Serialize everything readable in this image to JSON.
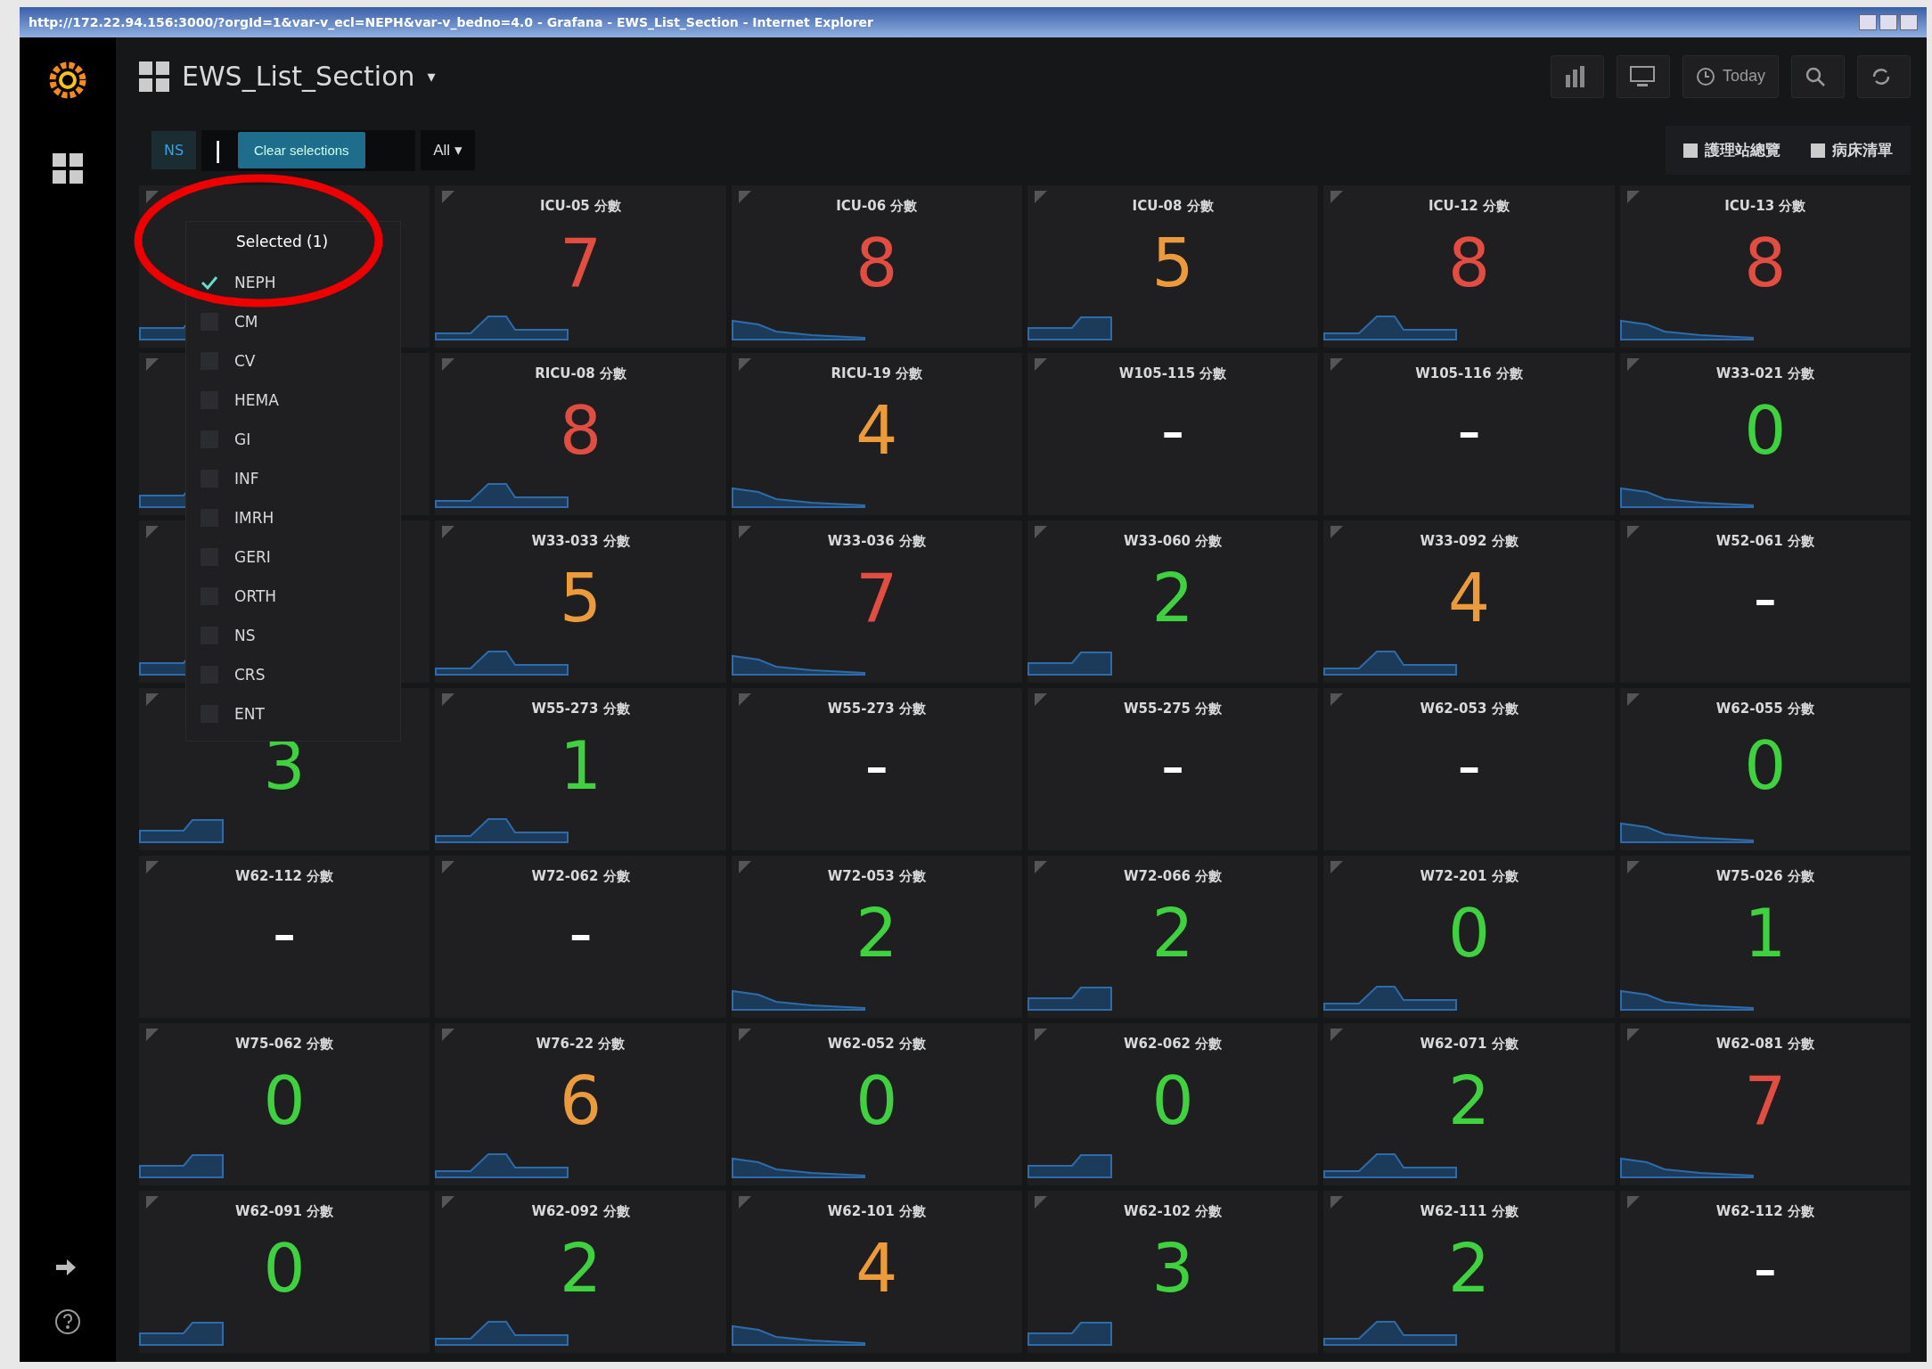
{
  "window": {
    "title": "http://172.22.94.156:3000/?orgId=1&var-v_ecl=NEPH&var-v_bedno=4.0 - Grafana - EWS_List_Section - Internet Explorer"
  },
  "header": {
    "dashboard_title": "EWS_List_Section",
    "caret": "▾",
    "time_picker": "Today"
  },
  "variables": {
    "label": "NS",
    "cursor": "|",
    "clear_button": "Clear selections",
    "all_dropdown": "All ▾"
  },
  "links": [
    "護理站總覽",
    "病床清單"
  ],
  "dropdown": {
    "header": "Selected (1)",
    "options": [
      {
        "label": "NEPH",
        "checked": true
      },
      {
        "label": "CM",
        "checked": false
      },
      {
        "label": "CV",
        "checked": false
      },
      {
        "label": "HEMA",
        "checked": false
      },
      {
        "label": "GI",
        "checked": false
      },
      {
        "label": "INF",
        "checked": false
      },
      {
        "label": "IMRH",
        "checked": false
      },
      {
        "label": "GERI",
        "checked": false
      },
      {
        "label": "ORTH",
        "checked": false
      },
      {
        "label": "NS",
        "checked": false
      },
      {
        "label": "CRS",
        "checked": false
      },
      {
        "label": "ENT",
        "checked": false
      }
    ]
  },
  "panels": [
    {
      "kind": "covered",
      "sparkline": true
    },
    {
      "kind": "stat",
      "title": "ICU-05 分數",
      "value": "7",
      "color": "#e24d42",
      "sparkline": true
    },
    {
      "kind": "stat",
      "title": "ICU-06 分數",
      "value": "8",
      "color": "#e24d42",
      "sparkline": true
    },
    {
      "kind": "stat",
      "title": "ICU-08 分數",
      "value": "5",
      "color": "#eb9a3c",
      "sparkline": true
    },
    {
      "kind": "stat",
      "title": "ICU-12 分數",
      "value": "8",
      "color": "#e24d42",
      "sparkline": true
    },
    {
      "kind": "stat",
      "title": "ICU-13 分數",
      "value": "8",
      "color": "#e24d42",
      "sparkline": true
    },
    {
      "kind": "covered",
      "sparkline": true
    },
    {
      "kind": "stat",
      "title": "RICU-08 分數",
      "value": "8",
      "color": "#e24d42",
      "sparkline": true
    },
    {
      "kind": "stat",
      "title": "RICU-19 分數",
      "value": "4",
      "color": "#eb9a3c",
      "sparkline": true
    },
    {
      "kind": "stat",
      "title": "W105-115 分數",
      "value": "-",
      "color": "#ffffff",
      "sparkline": false
    },
    {
      "kind": "stat",
      "title": "W105-116 分數",
      "value": "-",
      "color": "#ffffff",
      "sparkline": false
    },
    {
      "kind": "stat",
      "title": "W33-021 分數",
      "value": "0",
      "color": "#3fd13f",
      "sparkline": true
    },
    {
      "kind": "covered",
      "sparkline": true
    },
    {
      "kind": "stat",
      "title": "W33-033 分數",
      "value": "5",
      "color": "#eb9a3c",
      "sparkline": true
    },
    {
      "kind": "stat",
      "title": "W33-036 分數",
      "value": "7",
      "color": "#e24d42",
      "sparkline": true
    },
    {
      "kind": "stat",
      "title": "W33-060 分數",
      "value": "2",
      "color": "#3fd13f",
      "sparkline": true
    },
    {
      "kind": "stat",
      "title": "W33-092 分數",
      "value": "4",
      "color": "#eb9a3c",
      "sparkline": true
    },
    {
      "kind": "stat",
      "title": "W52-061 分數",
      "value": "-",
      "color": "#ffffff",
      "sparkline": false
    },
    {
      "kind": "stat",
      "value": "3",
      "color": "#3fd13f",
      "sparkline": true
    },
    {
      "kind": "stat",
      "title": "W55-273 分數",
      "value": "1",
      "color": "#3fd13f",
      "sparkline": true
    },
    {
      "kind": "stat",
      "title": "W55-273 分數",
      "value": "-",
      "color": "#ffffff",
      "sparkline": false
    },
    {
      "kind": "stat",
      "title": "W55-275 分數",
      "value": "-",
      "color": "#ffffff",
      "sparkline": false
    },
    {
      "kind": "stat",
      "title": "W62-053 分數",
      "value": "-",
      "color": "#ffffff",
      "sparkline": false
    },
    {
      "kind": "stat",
      "title": "W62-055 分數",
      "value": "0",
      "color": "#3fd13f",
      "sparkline": true
    },
    {
      "kind": "stat",
      "title": "W62-112 分數",
      "value": "-",
      "color": "#ffffff",
      "sparkline": false
    },
    {
      "kind": "stat",
      "title": "W72-062 分數",
      "value": "-",
      "color": "#ffffff",
      "sparkline": false
    },
    {
      "kind": "stat",
      "title": "W72-053 分數",
      "value": "2",
      "color": "#3fd13f",
      "sparkline": true
    },
    {
      "kind": "stat",
      "title": "W72-066 分數",
      "value": "2",
      "color": "#3fd13f",
      "sparkline": true
    },
    {
      "kind": "stat",
      "title": "W72-201 分數",
      "value": "0",
      "color": "#3fd13f",
      "sparkline": true
    },
    {
      "kind": "stat",
      "title": "W75-026 分數",
      "value": "1",
      "color": "#3fd13f",
      "sparkline": true
    },
    {
      "kind": "stat",
      "title": "W75-062 分數",
      "value": "0",
      "color": "#3fd13f",
      "sparkline": true
    },
    {
      "kind": "stat",
      "title": "W76-22 分數",
      "value": "6",
      "color": "#eb9a3c",
      "sparkline": true
    },
    {
      "kind": "stat",
      "title": "W62-052 分數",
      "value": "0",
      "color": "#3fd13f",
      "sparkline": true
    },
    {
      "kind": "stat",
      "title": "W62-062 分數",
      "value": "0",
      "color": "#3fd13f",
      "sparkline": true
    },
    {
      "kind": "stat",
      "title": "W62-071 分數",
      "value": "2",
      "color": "#3fd13f",
      "sparkline": true
    },
    {
      "kind": "stat",
      "title": "W62-081 分數",
      "value": "7",
      "color": "#e24d42",
      "sparkline": true
    },
    {
      "kind": "stat",
      "title": "W62-091 分數",
      "value": "0",
      "color": "#3fd13f",
      "sparkline": true
    },
    {
      "kind": "stat",
      "title": "W62-092 分數",
      "value": "2",
      "color": "#3fd13f",
      "sparkline": true
    },
    {
      "kind": "stat",
      "title": "W62-101 分數",
      "value": "4",
      "color": "#eb9a3c",
      "sparkline": true
    },
    {
      "kind": "stat",
      "title": "W62-102 分數",
      "value": "3",
      "color": "#3fd13f",
      "sparkline": true
    },
    {
      "kind": "stat",
      "title": "W62-111 分數",
      "value": "2",
      "color": "#3fd13f",
      "sparkline": true
    },
    {
      "kind": "stat",
      "title": "W62-112 分數",
      "value": "-",
      "color": "#ffffff",
      "sparkline": false
    }
  ]
}
